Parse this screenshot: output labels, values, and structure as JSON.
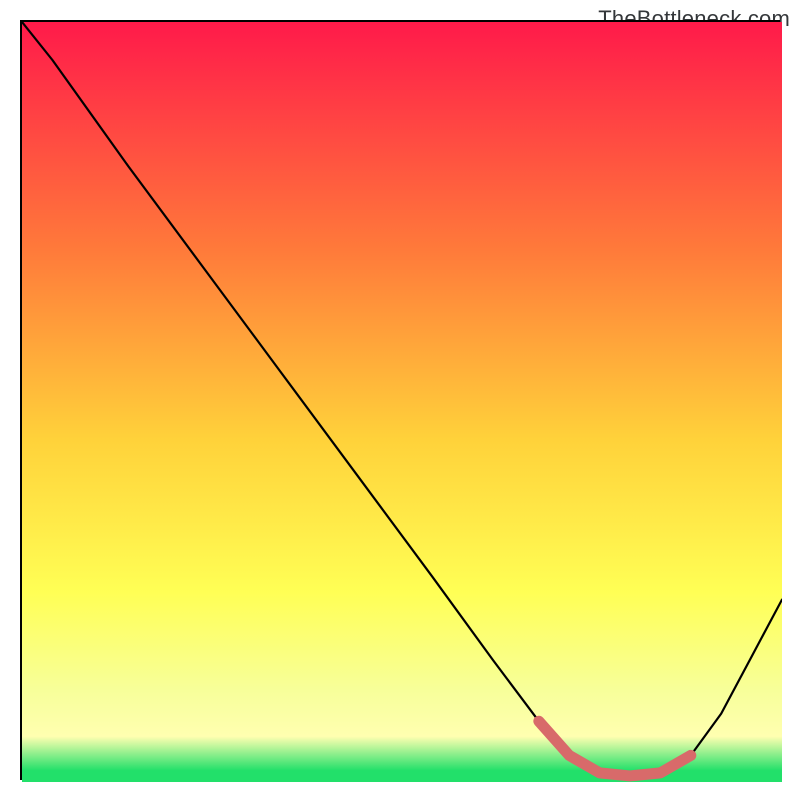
{
  "watermark": "TheBottleneck.com",
  "colors": {
    "top": "#ff1a4a",
    "mid1": "#ff7a3a",
    "mid2": "#ffd23a",
    "mid3": "#ffff55",
    "mid4": "#f7ff9a",
    "bottom_yellow": "#ffffb0",
    "green": "#22e06a",
    "curve_black": "#000000",
    "valley_red": "#d86a6a"
  },
  "chart_data": {
    "type": "line",
    "title": "",
    "xlabel": "",
    "ylabel": "",
    "xlim": [
      0,
      100
    ],
    "ylim": [
      0,
      100
    ],
    "legend": false,
    "grid": false,
    "series": [
      {
        "name": "bottleneck-curve",
        "x": [
          0,
          4,
          14,
          24,
          34,
          44,
          54,
          62,
          68,
          72,
          76,
          80,
          84,
          88,
          92,
          96,
          100
        ],
        "y": [
          100,
          95,
          81,
          67.5,
          54,
          40.5,
          27,
          16,
          8,
          3.5,
          1.2,
          0.8,
          1.2,
          3.5,
          9,
          16.5,
          24
        ]
      }
    ],
    "valley_highlight": {
      "name": "optimal-range",
      "x": [
        68,
        72,
        76,
        80,
        84,
        88
      ],
      "y": [
        8,
        3.5,
        1.2,
        0.8,
        1.2,
        3.5
      ]
    },
    "gradient_stops": [
      {
        "offset": 0.0,
        "color": "#ff1a4a"
      },
      {
        "offset": 0.3,
        "color": "#ff7a3a"
      },
      {
        "offset": 0.55,
        "color": "#ffd23a"
      },
      {
        "offset": 0.75,
        "color": "#ffff55"
      },
      {
        "offset": 0.88,
        "color": "#f7ff9a"
      },
      {
        "offset": 0.94,
        "color": "#ffffb0"
      },
      {
        "offset": 0.985,
        "color": "#22e06a"
      },
      {
        "offset": 1.0,
        "color": "#22e06a"
      }
    ]
  }
}
